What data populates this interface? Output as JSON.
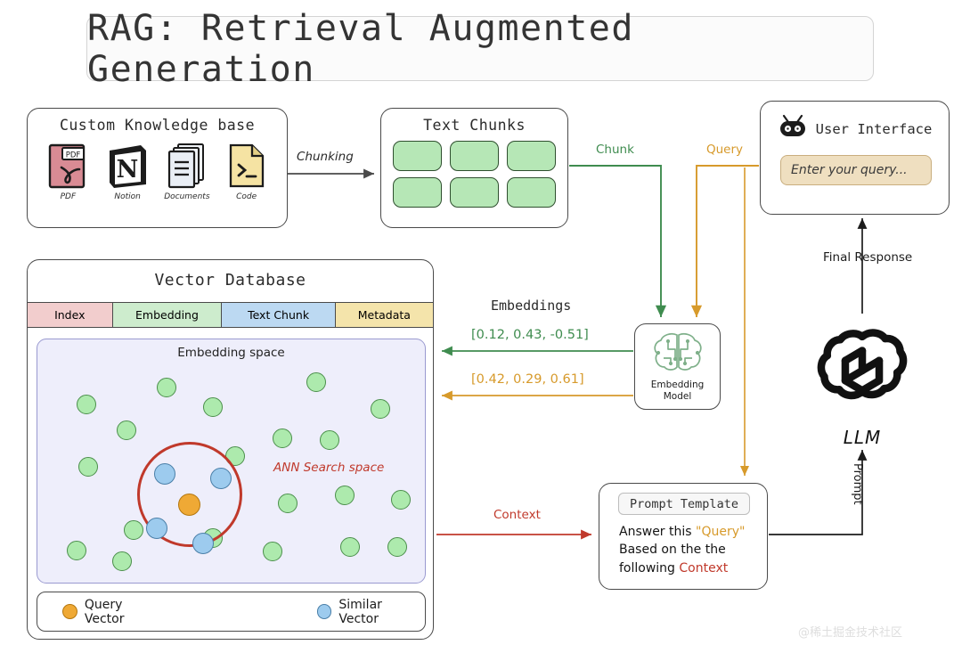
{
  "title": "RAG: Retrieval Augmented Generation",
  "knowledge_base": {
    "title": "Custom Knowledge base",
    "items": [
      {
        "label": "PDF",
        "icon": "pdf-file-icon",
        "badge": "PDF"
      },
      {
        "label": "Notion",
        "icon": "notion-logo-icon",
        "glyph": "N"
      },
      {
        "label": "Documents",
        "icon": "documents-stack-icon"
      },
      {
        "label": "Code",
        "icon": "code-file-icon",
        "glyph": ">_"
      }
    ]
  },
  "text_chunks": {
    "title": "Text Chunks",
    "count": 6,
    "chunk_color": "#b6e7b6"
  },
  "user_interface": {
    "title": "User Interface",
    "icon": "robot-bot-icon",
    "input_placeholder": "Enter your query...",
    "input_value": ""
  },
  "vector_database": {
    "title": "Vector Database",
    "columns": [
      {
        "label": "Index",
        "color": "#f2cdcd"
      },
      {
        "label": "Embedding",
        "color": "#cdeccd"
      },
      {
        "label": "Text Chunk",
        "color": "#bcd9f2"
      },
      {
        "label": "Metadata",
        "color": "#f4e4ab"
      }
    ],
    "embedding_space": {
      "title": "Embedding space",
      "ann_label": "ANN Search space",
      "ann_circle_color": "#c0392b"
    },
    "legend": [
      {
        "label": "Query Vector",
        "color": "#efa935"
      },
      {
        "label": "Similar Vector",
        "color": "#9dcbee"
      }
    ]
  },
  "embedding_model": {
    "label_line1": "Embedding",
    "label_line2": "Model",
    "icon": "brain-circuit-icon"
  },
  "prompt_template": {
    "chip_label": "Prompt Template",
    "line1_prefix": "Answer this ",
    "line1_token": "\"Query\"",
    "line2": "Based on the the",
    "line3_prefix": "following ",
    "line3_token": "Context"
  },
  "llm": {
    "label": "LLM",
    "icon": "openai-knot-logo-icon"
  },
  "edges": {
    "chunking": "Chunking",
    "chunk": "Chunk",
    "query": "Query",
    "embeddings": "Embeddings",
    "vector_green": "[0.12, 0.43, -0.51]",
    "vector_orange": "[0.42, 0.29, 0.61]",
    "context": "Context",
    "final_response": "Final Response",
    "prompt": "Prompt"
  },
  "colors": {
    "green": "#3f8c4f",
    "orange": "#d79a2b",
    "red": "#c0392b",
    "dark": "#4a4a4a"
  },
  "watermark": "@稀土掘金技术社区",
  "chart_data": {
    "type": "scatter",
    "title": "Embedding space",
    "note": "2-D projection of stored vectors inside the Vector Database panel",
    "series": [
      {
        "name": "Query Vector",
        "color": "#efa935",
        "points": [
          [
            0.385,
            0.555
          ]
        ]
      },
      {
        "name": "Similar Vector",
        "color": "#9dcbee",
        "points": [
          [
            0.325,
            0.44
          ],
          [
            0.47,
            0.455
          ],
          [
            0.305,
            0.665
          ],
          [
            0.425,
            0.725
          ]
        ]
      },
      {
        "name": "Other Vector",
        "color": "#adeaad",
        "points": [
          [
            0.12,
            0.255
          ],
          [
            0.325,
            0.19
          ],
          [
            0.445,
            0.265
          ],
          [
            0.22,
            0.36
          ],
          [
            0.125,
            0.51
          ],
          [
            0.715,
            0.175
          ],
          [
            0.88,
            0.285
          ],
          [
            0.625,
            0.4
          ],
          [
            0.745,
            0.405
          ],
          [
            0.5,
            0.475
          ],
          [
            0.64,
            0.67
          ],
          [
            0.79,
            0.635
          ],
          [
            0.935,
            0.655
          ],
          [
            0.235,
            0.775
          ],
          [
            0.445,
            0.805
          ],
          [
            0.6,
            0.86
          ],
          [
            0.095,
            0.855
          ],
          [
            0.21,
            0.9
          ],
          [
            0.8,
            0.845
          ],
          [
            0.925,
            0.845
          ]
        ]
      }
    ],
    "ann_region": {
      "label": "ANN Search space",
      "center": [
        0.385,
        0.575
      ],
      "radius": 0.135
    }
  }
}
